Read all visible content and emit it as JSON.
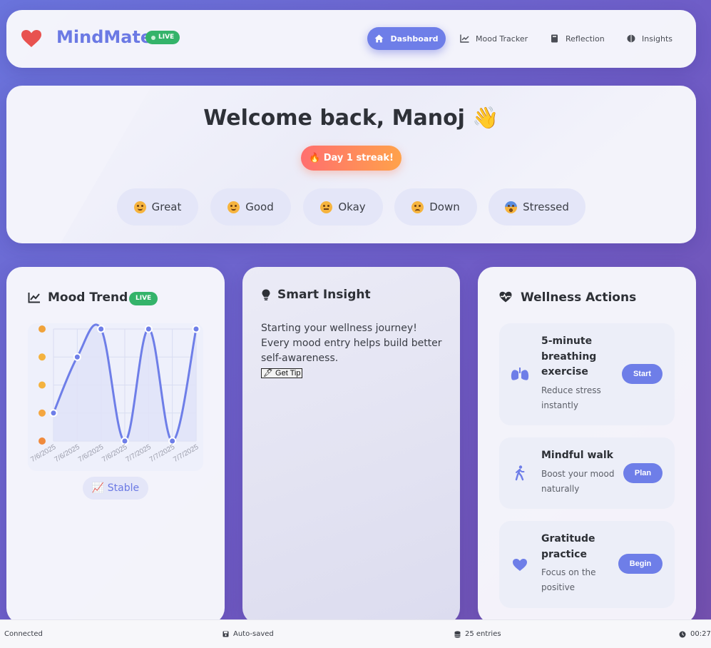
{
  "app": {
    "title": "MindMate",
    "live_badge": "LIVE"
  },
  "nav": {
    "items": [
      {
        "label": "Dashboard",
        "icon": "home-icon",
        "active": true
      },
      {
        "label": "Mood Tracker",
        "icon": "chart-line-icon",
        "active": false
      },
      {
        "label": "Reflection",
        "icon": "book-icon",
        "active": false
      },
      {
        "label": "Insights",
        "icon": "brain-icon",
        "active": false
      }
    ]
  },
  "hero": {
    "welcome": "Welcome back, Manoj 👋",
    "streak": "🔥 Day 1 streak!",
    "moods": [
      {
        "label": "Great",
        "icon": "smiling-face-icon"
      },
      {
        "label": "Good",
        "icon": "slight-smile-face-icon"
      },
      {
        "label": "Okay",
        "icon": "neutral-face-icon"
      },
      {
        "label": "Down",
        "icon": "pensive-face-icon"
      },
      {
        "label": "Stressed",
        "icon": "fearful-face-icon"
      }
    ]
  },
  "trend": {
    "title": "Mood Trend",
    "live_badge": "LIVE",
    "stable_label": "📈 Stable"
  },
  "chart_data": {
    "type": "line",
    "categories": [
      "7/6/2025",
      "7/6/2025",
      "7/6/2025",
      "7/6/2025",
      "7/7/2025",
      "7/7/2025",
      "7/7/2025"
    ],
    "values": [
      2,
      4,
      5,
      1,
      5,
      1,
      5
    ],
    "ylim": [
      1,
      5
    ],
    "y_tick_icons": [
      "smiling-face-icon",
      "slight-smile-face-icon",
      "neutral-face-icon",
      "pensive-face-icon",
      "angry-face-icon"
    ],
    "grid": true,
    "colors": {
      "line": "#6e7ee8",
      "fill": "#dfe3f8"
    }
  },
  "insight": {
    "title": "Smart Insight",
    "text": "Starting your wellness journey! Every mood entry helps build better self-awareness.",
    "tip_button": "🖋 Get Tip"
  },
  "actions": {
    "title": "Wellness Actions",
    "items": [
      {
        "title": "5-minute breathing exercise",
        "subtitle": "Reduce stress instantly",
        "button": "Start",
        "icon": "lungs-icon"
      },
      {
        "title": "Mindful walk",
        "subtitle": "Boost your mood naturally",
        "button": "Plan",
        "icon": "walking-icon"
      },
      {
        "title": "Gratitude practice",
        "subtitle": "Focus on the positive",
        "button": "Begin",
        "icon": "heart-icon"
      }
    ]
  },
  "status": {
    "connection": "Connected",
    "saved": "Auto-saved",
    "entries": "25 entries",
    "time": "00:27"
  },
  "colors": {
    "accent": "#6e7ee8",
    "live": "#34b36a",
    "heart": "#e8524f"
  }
}
